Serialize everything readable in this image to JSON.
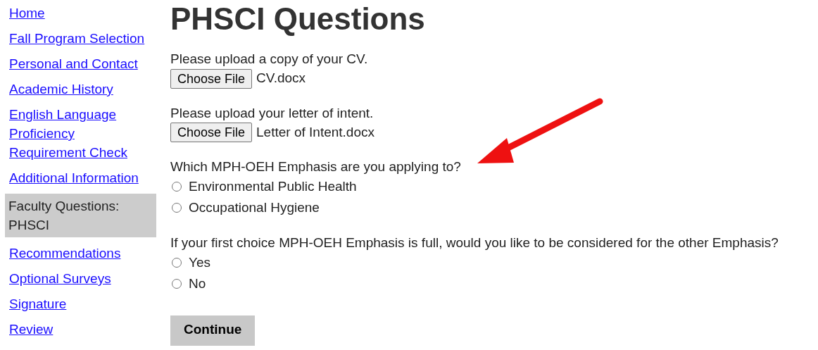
{
  "sidebar": {
    "items": [
      {
        "label": "Home",
        "selected": false
      },
      {
        "label": "Fall Program Selection",
        "selected": false
      },
      {
        "label": "Personal and Contact",
        "selected": false
      },
      {
        "label": "Academic History",
        "selected": false
      },
      {
        "label": "English Language Proficiency Requirement Check",
        "selected": false
      },
      {
        "label": "Additional Information",
        "selected": false
      },
      {
        "label": "Faculty Questions: PHSCI",
        "selected": true
      },
      {
        "label": "Recommendations",
        "selected": false
      },
      {
        "label": "Optional Surveys",
        "selected": false
      },
      {
        "label": "Signature",
        "selected": false
      },
      {
        "label": "Review",
        "selected": false
      }
    ]
  },
  "page_title": "PHSCI Questions",
  "questions": [
    {
      "kind": "file",
      "prompt": "Please upload a copy of your CV.",
      "button": "Choose File",
      "file_name": "CV.docx"
    },
    {
      "kind": "file",
      "prompt": "Please upload your letter of intent.",
      "button": "Choose File",
      "file_name": "Letter of Intent.docx"
    },
    {
      "kind": "radio",
      "prompt": "Which MPH-OEH Emphasis are you applying to?",
      "options": [
        {
          "label": "Environmental Public Health",
          "selected": false
        },
        {
          "label": "Occupational Hygiene",
          "selected": false
        }
      ]
    },
    {
      "kind": "radio",
      "prompt": "If your first choice MPH-OEH Emphasis is full, would you like to be considered for the other Emphasis?",
      "options": [
        {
          "label": "Yes",
          "selected": false
        },
        {
          "label": "No",
          "selected": false
        }
      ]
    }
  ],
  "continue_button": "Continue"
}
